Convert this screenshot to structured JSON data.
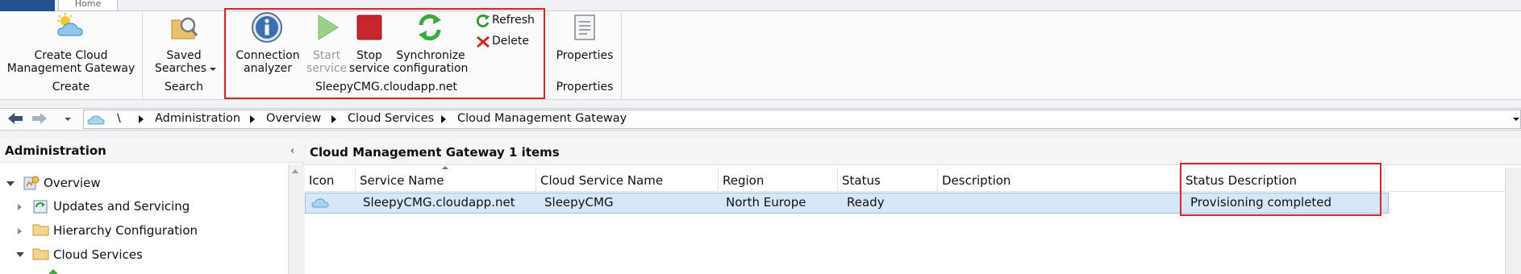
{
  "ribbon": {
    "home_tab_label": "Home",
    "groups": {
      "create": {
        "button_label_line1": "Create Cloud",
        "button_label_line2": "Management Gateway",
        "group_label": "Create"
      },
      "search": {
        "button_label_line1": "Saved",
        "button_label_line2": "Searches",
        "group_label": "Search"
      },
      "cmg": {
        "connection_analyzer_line1": "Connection",
        "connection_analyzer_line2": "analyzer",
        "start_service_line1": "Start",
        "start_service_line2": "service",
        "stop_service_line1": "Stop",
        "stop_service_line2": "service",
        "synchronize_line1": "Synchronize",
        "synchronize_line2": "configuration",
        "refresh_label": "Refresh",
        "delete_label": "Delete",
        "group_label": "SleepyCMG.cloudapp.net"
      },
      "properties": {
        "button_label": "Properties",
        "group_label": "Properties"
      }
    }
  },
  "breadcrumb": {
    "root": "\\",
    "items": [
      "Administration",
      "Overview",
      "Cloud Services",
      "Cloud Management Gateway"
    ]
  },
  "left_panel": {
    "title": "Administration",
    "tree": [
      {
        "label": "Overview",
        "state": "expanded"
      },
      {
        "label": "Updates and Servicing",
        "state": "collapsed"
      },
      {
        "label": "Hierarchy Configuration",
        "state": "collapsed"
      },
      {
        "label": "Cloud Services",
        "state": "expanded"
      }
    ]
  },
  "right_panel": {
    "title": "Cloud Management Gateway 1 items",
    "columns": [
      "Icon",
      "Service Name",
      "Cloud Service Name",
      "Region",
      "Status",
      "Description",
      "Status Description"
    ],
    "rows": [
      {
        "service_name": "SleepyCMG.cloudapp.net",
        "cloud_service_name": "SleepyCMG",
        "region": "North Europe",
        "status": "Ready",
        "description": "",
        "status_description": "Provisioning completed"
      }
    ]
  },
  "colors": {
    "highlight_box": "#d8242a",
    "selected_row": "#d7e7f8",
    "ribbon_bg": "#fbfbfc",
    "start_disabled": "#9ad08a",
    "stop_red": "#c8262e",
    "sync_green": "#3aa83a"
  },
  "icons": [
    "cloud-sun-icon",
    "saved-search-folder-icon",
    "info-icon",
    "play-icon",
    "stop-icon",
    "sync-icon",
    "refresh-icon",
    "delete-x-icon",
    "properties-icon",
    "back-arrow-icon",
    "forward-arrow-icon",
    "cloud-icon",
    "folder-icon",
    "overview-icon",
    "updates-icon"
  ]
}
